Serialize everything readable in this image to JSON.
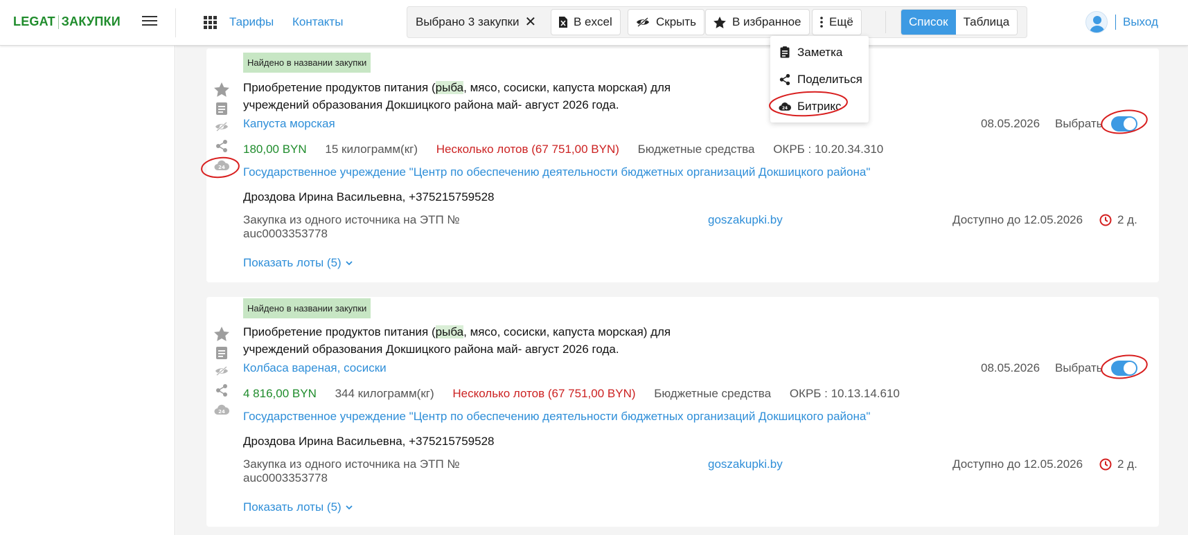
{
  "header": {
    "logo_left": "LEGAT",
    "logo_right": "ЗАКУПКИ",
    "nav": [
      "Тарифы",
      "Контакты"
    ],
    "selection_label": "Выбрано 3 закупки",
    "buttons": {
      "excel": "В excel",
      "hide": "Скрыть",
      "favorites": "В избранное",
      "more": "Ещё"
    },
    "view_modes": {
      "list": "Список",
      "table": "Таблица",
      "active": "list"
    },
    "logout": "Выход"
  },
  "dropdown": {
    "items": [
      {
        "label": "Заметка",
        "icon": "note-icon"
      },
      {
        "label": "Поделиться",
        "icon": "share-icon"
      },
      {
        "label": "Битрикс",
        "icon": "bitrix24-icon"
      }
    ]
  },
  "cards": [
    {
      "badge": "Найдено в названии закупки",
      "title_before": "Приобретение продуктов питания (",
      "title_highlight": "рыба",
      "title_after": ", мясо, сосиски, капуста морская) для учреждений образования Докшицкого района май- август 2026 года.",
      "subject": "Капуста морская",
      "date": "08.05.2026",
      "select_label": "Выбрать",
      "selected": true,
      "price": "180,00 BYN",
      "quantity": "15 килограмм(кг)",
      "lots_summary": "Несколько лотов (67 751,00 BYN)",
      "funding": "Бюджетные средства",
      "okrb": "ОКРБ : 10.20.34.310",
      "organization": "Государственное учреждение \"Центр по обеспечению деятельности бюджетных организаций Докшицкого района\"",
      "contact": "Дроздова Ирина Васильевна, +375215759528",
      "source": "Закупка из одного источника на ЭТП № auc0003353778",
      "site": "goszakupki.by",
      "available_until": "Доступно до 12.05.2026",
      "days_left": "2 д.",
      "show_lots": "Показать лоты (5)"
    },
    {
      "badge": "Найдено в названии закупки",
      "title_before": "Приобретение продуктов питания (",
      "title_highlight": "рыба",
      "title_after": ", мясо, сосиски, капуста морская) для учреждений образования Докшицкого района май- август 2026 года.",
      "subject": "Колбаса вареная, сосиски",
      "date": "08.05.2026",
      "select_label": "Выбрать",
      "selected": true,
      "price": "4 816,00 BYN",
      "quantity": "344 килограмм(кг)",
      "lots_summary": "Несколько лотов (67 751,00 BYN)",
      "funding": "Бюджетные средства",
      "okrb": "ОКРБ : 10.13.14.610",
      "organization": "Государственное учреждение \"Центр по обеспечению деятельности бюджетных организаций Докшицкого района\"",
      "contact": "Дроздова Ирина Васильевна, +375215759528",
      "source": "Закупка из одного источника на ЭТП № auc0003353778",
      "site": "goszakupki.by",
      "available_until": "Доступно до 12.05.2026",
      "days_left": "2 д.",
      "show_lots": "Показать лоты (5)"
    }
  ],
  "colors": {
    "accent": "#2e8ed8",
    "brand": "#1f8c2c",
    "danger": "#c22222",
    "highlight": "#d9eed6",
    "annotation": "#d81e1e"
  }
}
